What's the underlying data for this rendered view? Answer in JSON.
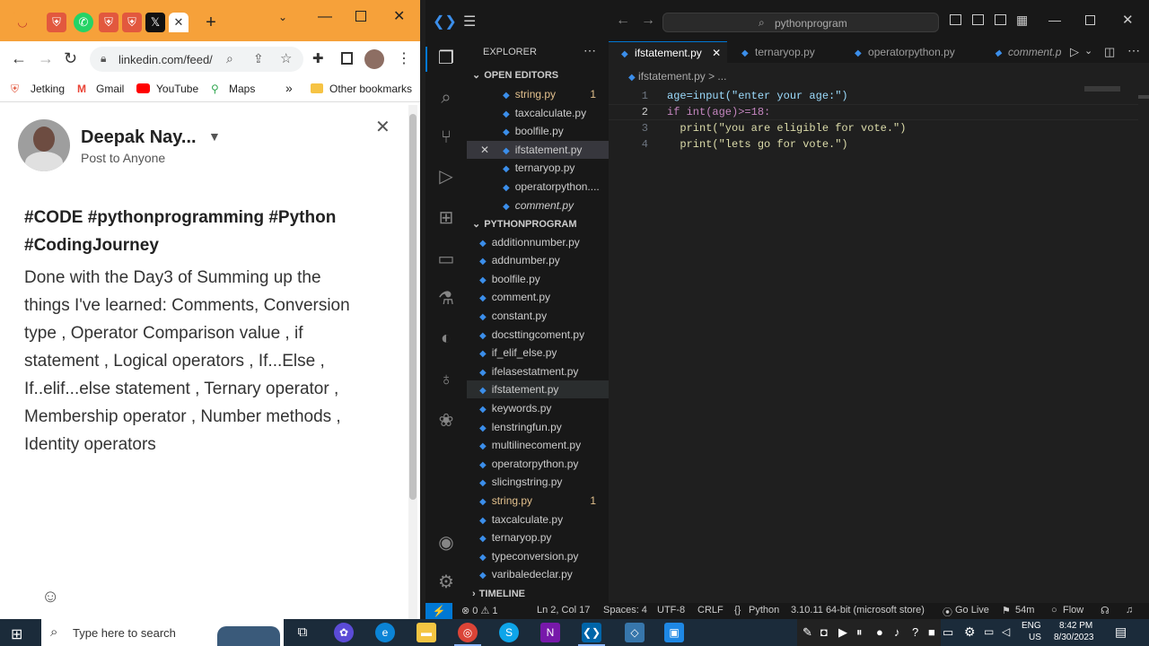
{
  "browser": {
    "url": "linkedin.com/feed/",
    "bookmarks": [
      "Jetking",
      "Gmail",
      "YouTube",
      "Maps",
      "Other bookmarks"
    ],
    "overflow": "»",
    "tab_close": "✕",
    "new_tab": "+"
  },
  "post": {
    "author": "Deepak Nay...",
    "audience": "Post to Anyone",
    "hashtags_line1": "#CODE #pythonprogramming #Python",
    "hashtags_line2": "#CodingJourney",
    "body_lines": [
      "Done with the Day3 of  Summing up the",
      "things I've learned: Comments, Conversion",
      "type , Operator Comparison value ,  if",
      "statement  , Logical operators , If...Else  ,",
      "If..elif...else statement , Ternary operator ,",
      "Membership operator , Number methods ,",
      "Identity operators"
    ]
  },
  "vscode": {
    "search": "pythonprogram",
    "explorer_title": "EXPLORER",
    "open_editors_label": "OPEN EDITORS",
    "open_editors": [
      {
        "name": "string.py",
        "badge": "1",
        "modified": true
      },
      {
        "name": "taxcalculate.py",
        "badge": ""
      },
      {
        "name": "boolfile.py",
        "badge": ""
      },
      {
        "name": "ifstatement.py",
        "badge": "",
        "active": true
      },
      {
        "name": "ternaryop.py",
        "badge": ""
      },
      {
        "name": "operatorpython....",
        "badge": ""
      },
      {
        "name": "comment.py",
        "badge": "",
        "italic": true
      }
    ],
    "project_label": "PYTHONPROGRAM",
    "files": [
      {
        "name": "additionnumber.py",
        "badge": ""
      },
      {
        "name": "addnumber.py",
        "badge": ""
      },
      {
        "name": "boolfile.py",
        "badge": ""
      },
      {
        "name": "comment.py",
        "badge": ""
      },
      {
        "name": "constant.py",
        "badge": ""
      },
      {
        "name": "docsttingcoment.py",
        "badge": ""
      },
      {
        "name": "if_elif_else.py",
        "badge": ""
      },
      {
        "name": "ifelasestatment.py",
        "badge": ""
      },
      {
        "name": "ifstatement.py",
        "badge": "",
        "selected": true
      },
      {
        "name": "keywords.py",
        "badge": ""
      },
      {
        "name": "lenstringfun.py",
        "badge": ""
      },
      {
        "name": "multilinecoment.py",
        "badge": ""
      },
      {
        "name": "operatorpython.py",
        "badge": ""
      },
      {
        "name": "slicingstring.py",
        "badge": ""
      },
      {
        "name": "string.py",
        "badge": "1",
        "modified": true
      },
      {
        "name": "taxcalculate.py",
        "badge": ""
      },
      {
        "name": "ternaryop.py",
        "badge": ""
      },
      {
        "name": "typeconversion.py",
        "badge": ""
      },
      {
        "name": "varibaledeclar.py",
        "badge": ""
      }
    ],
    "timeline_label": "TIMELINE",
    "tabs": [
      "ifstatement.py",
      "ternaryop.py",
      "operatorpython.py",
      "comment.p"
    ],
    "breadcrumb": "ifstatement.py > ...",
    "code_lines": [
      "age=input(\"enter your age:\")",
      "if int(age)>=18:",
      "  print(\"you are eligible for vote.\")",
      "  print(\"lets go for vote.\")"
    ],
    "status": {
      "errors": "⊗ 0 ⚠ 1",
      "position": "Ln 2, Col 17",
      "spaces": "Spaces: 4",
      "encoding": "UTF-8",
      "eol": "CRLF",
      "language": "Python",
      "interpreter": "3.10.11 64-bit (microsoft store)",
      "golive": "Go Live",
      "time": "54m",
      "flow": "Flow"
    }
  },
  "taskbar": {
    "search_placeholder": "Type here to search",
    "lang": "ENG",
    "region": "US",
    "clock_time": "8:42 PM",
    "clock_date": "8/30/2023"
  },
  "colors": {
    "chrome_tab_bg": "#f6a13a",
    "vscode_bg": "#1f1f1f",
    "accent": "#0078d4",
    "modified": "#e2c08d"
  }
}
